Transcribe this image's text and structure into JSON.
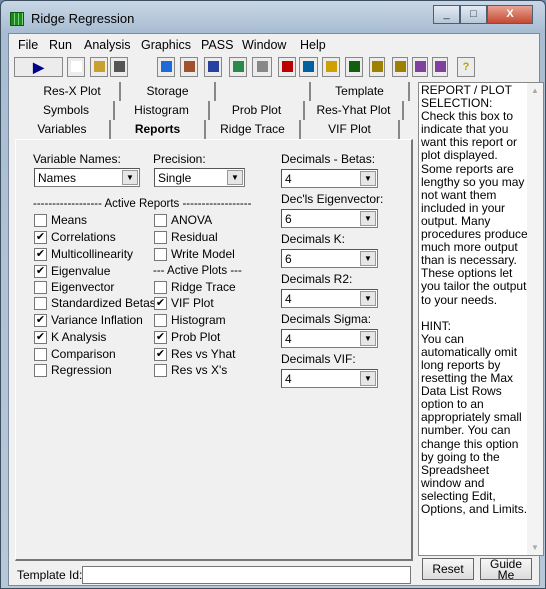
{
  "window": {
    "title": "Ridge Regression",
    "controls": [
      "_",
      "□",
      "X"
    ]
  },
  "menu": [
    "File",
    "Run",
    "Analysis",
    "Graphics",
    "PASS",
    "Window",
    "Help"
  ],
  "toolbar": {
    "icons": [
      "run-icon",
      "new-icon",
      "open-icon",
      "save-icon",
      "target-icon",
      "cube-icon",
      "document-icon",
      "globe-icon",
      "funnel-icon",
      "delete-icon",
      "two-t-icon",
      "mra-icon",
      "freq-icon",
      "bar-chart-icon",
      "box-plot-icon",
      "scatter-icon",
      "line-plot-icon",
      "help-icon"
    ],
    "labels": {
      "play": "▶",
      "help": "?"
    }
  },
  "tabs": {
    "row1": [
      "Res-X Plot",
      "Storage",
      "",
      "Template"
    ],
    "row2": [
      "Symbols",
      "Histogram",
      "Prob Plot",
      "Res-Yhat Plot"
    ],
    "row3": [
      "Variables",
      "Reports",
      "Ridge Trace",
      "VIF Plot"
    ],
    "active": "Reports"
  },
  "reports": {
    "variable_names": {
      "label": "Variable Names:",
      "value": "Names"
    },
    "precision": {
      "label": "Precision:",
      "value": "Single"
    },
    "active_reports_header": "------------------ Active Reports ------------------",
    "active_plots_header": "--- Active Plots ---",
    "col1": [
      {
        "label": "Means",
        "checked": false
      },
      {
        "label": "Correlations",
        "checked": true
      },
      {
        "label": "Multicollinearity",
        "checked": true
      },
      {
        "label": "Eigenvalue",
        "checked": true
      },
      {
        "label": "Eigenvector",
        "checked": false
      },
      {
        "label": "Standardized Betas",
        "checked": false
      },
      {
        "label": "Variance Inflation",
        "checked": true
      },
      {
        "label": "K Analysis",
        "checked": true
      },
      {
        "label": "Comparison",
        "checked": false
      },
      {
        "label": "Regression",
        "checked": false
      }
    ],
    "col2_reports": [
      {
        "label": "ANOVA",
        "checked": false
      },
      {
        "label": "Residual",
        "checked": false
      },
      {
        "label": "Write Model",
        "checked": false
      }
    ],
    "col2_plots": [
      {
        "label": "Ridge Trace",
        "checked": false
      },
      {
        "label": "VIF Plot",
        "checked": true
      },
      {
        "label": "Histogram",
        "checked": false
      },
      {
        "label": "Prob Plot",
        "checked": true
      },
      {
        "label": "Res vs Yhat",
        "checked": true
      },
      {
        "label": "Res vs X's",
        "checked": false
      }
    ],
    "decimals": [
      {
        "label": "Decimals - Betas:",
        "value": "4"
      },
      {
        "label": "Dec'ls Eigenvector:",
        "value": "6"
      },
      {
        "label": "Decimals K:",
        "value": "6"
      },
      {
        "label": "Decimals R2:",
        "value": "4"
      },
      {
        "label": "Decimals Sigma:",
        "value": "4"
      },
      {
        "label": "Decimals VIF:",
        "value": "4"
      }
    ]
  },
  "help": {
    "text": "REPORT / PLOT SELECTION:\nCheck this box to indicate that you want this report or plot displayed. Some reports are lengthy so you may not want them included in your output. Many procedures produce much more output than is necessary. These options let you tailor the output to your needs.\n\nHINT:\nYou can automatically omit long reports by resetting the Max Data List Rows option to an appropriately small number. You can change this option by going to the Spreadsheet window and selecting Edit, Options, and Limits.",
    "reset": "Reset",
    "guide": "Guide Me"
  },
  "template": {
    "label": "Template Id:",
    "value": ""
  }
}
